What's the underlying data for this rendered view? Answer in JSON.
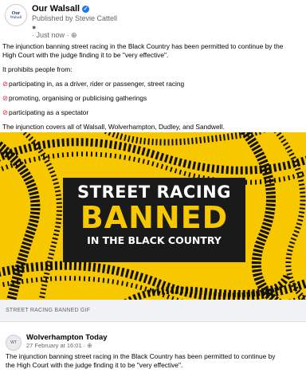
{
  "post": {
    "page_name": "Our Walsall",
    "avatar_text_1": "Our",
    "avatar_text_2": "Walsall",
    "published_by": "Published by Stevie Cattell",
    "timestamp": "· Just now · ",
    "paragraph_1_line_1": "The injunction banning street racing in the Black Country has been permitted to continue by the",
    "paragraph_1_line_2": "High Court with the judge finding it to be \"very effective\".",
    "paragraph_2": "It prohibits people from:",
    "bullets": [
      "participating in, as a driver, rider or passenger, street racing",
      "promoting, organising or publicising gatherings",
      "participating as a spectator"
    ],
    "paragraph_3": "The injunction covers all of Walsall, Wolverhampton, Dudley, and Sandwell."
  },
  "image": {
    "line_1": "STREET RACING",
    "line_2": "BANNED",
    "line_3": "IN THE BLACK COUNTRY",
    "caption": "STREET RACING BANNED GIF",
    "colors": {
      "background": "#f7c800",
      "banner": "#1a1a1a",
      "accent": "#f7c800"
    }
  },
  "shared_post": {
    "page_name": "Wolverhampton Today",
    "timestamp": "27 February at 16:01 · ",
    "text_line_1": "The injunction banning street racing in the Black Country has been permitted to continue by",
    "text_line_2": "the High Court with the judge finding it to be \"very effective\"."
  }
}
